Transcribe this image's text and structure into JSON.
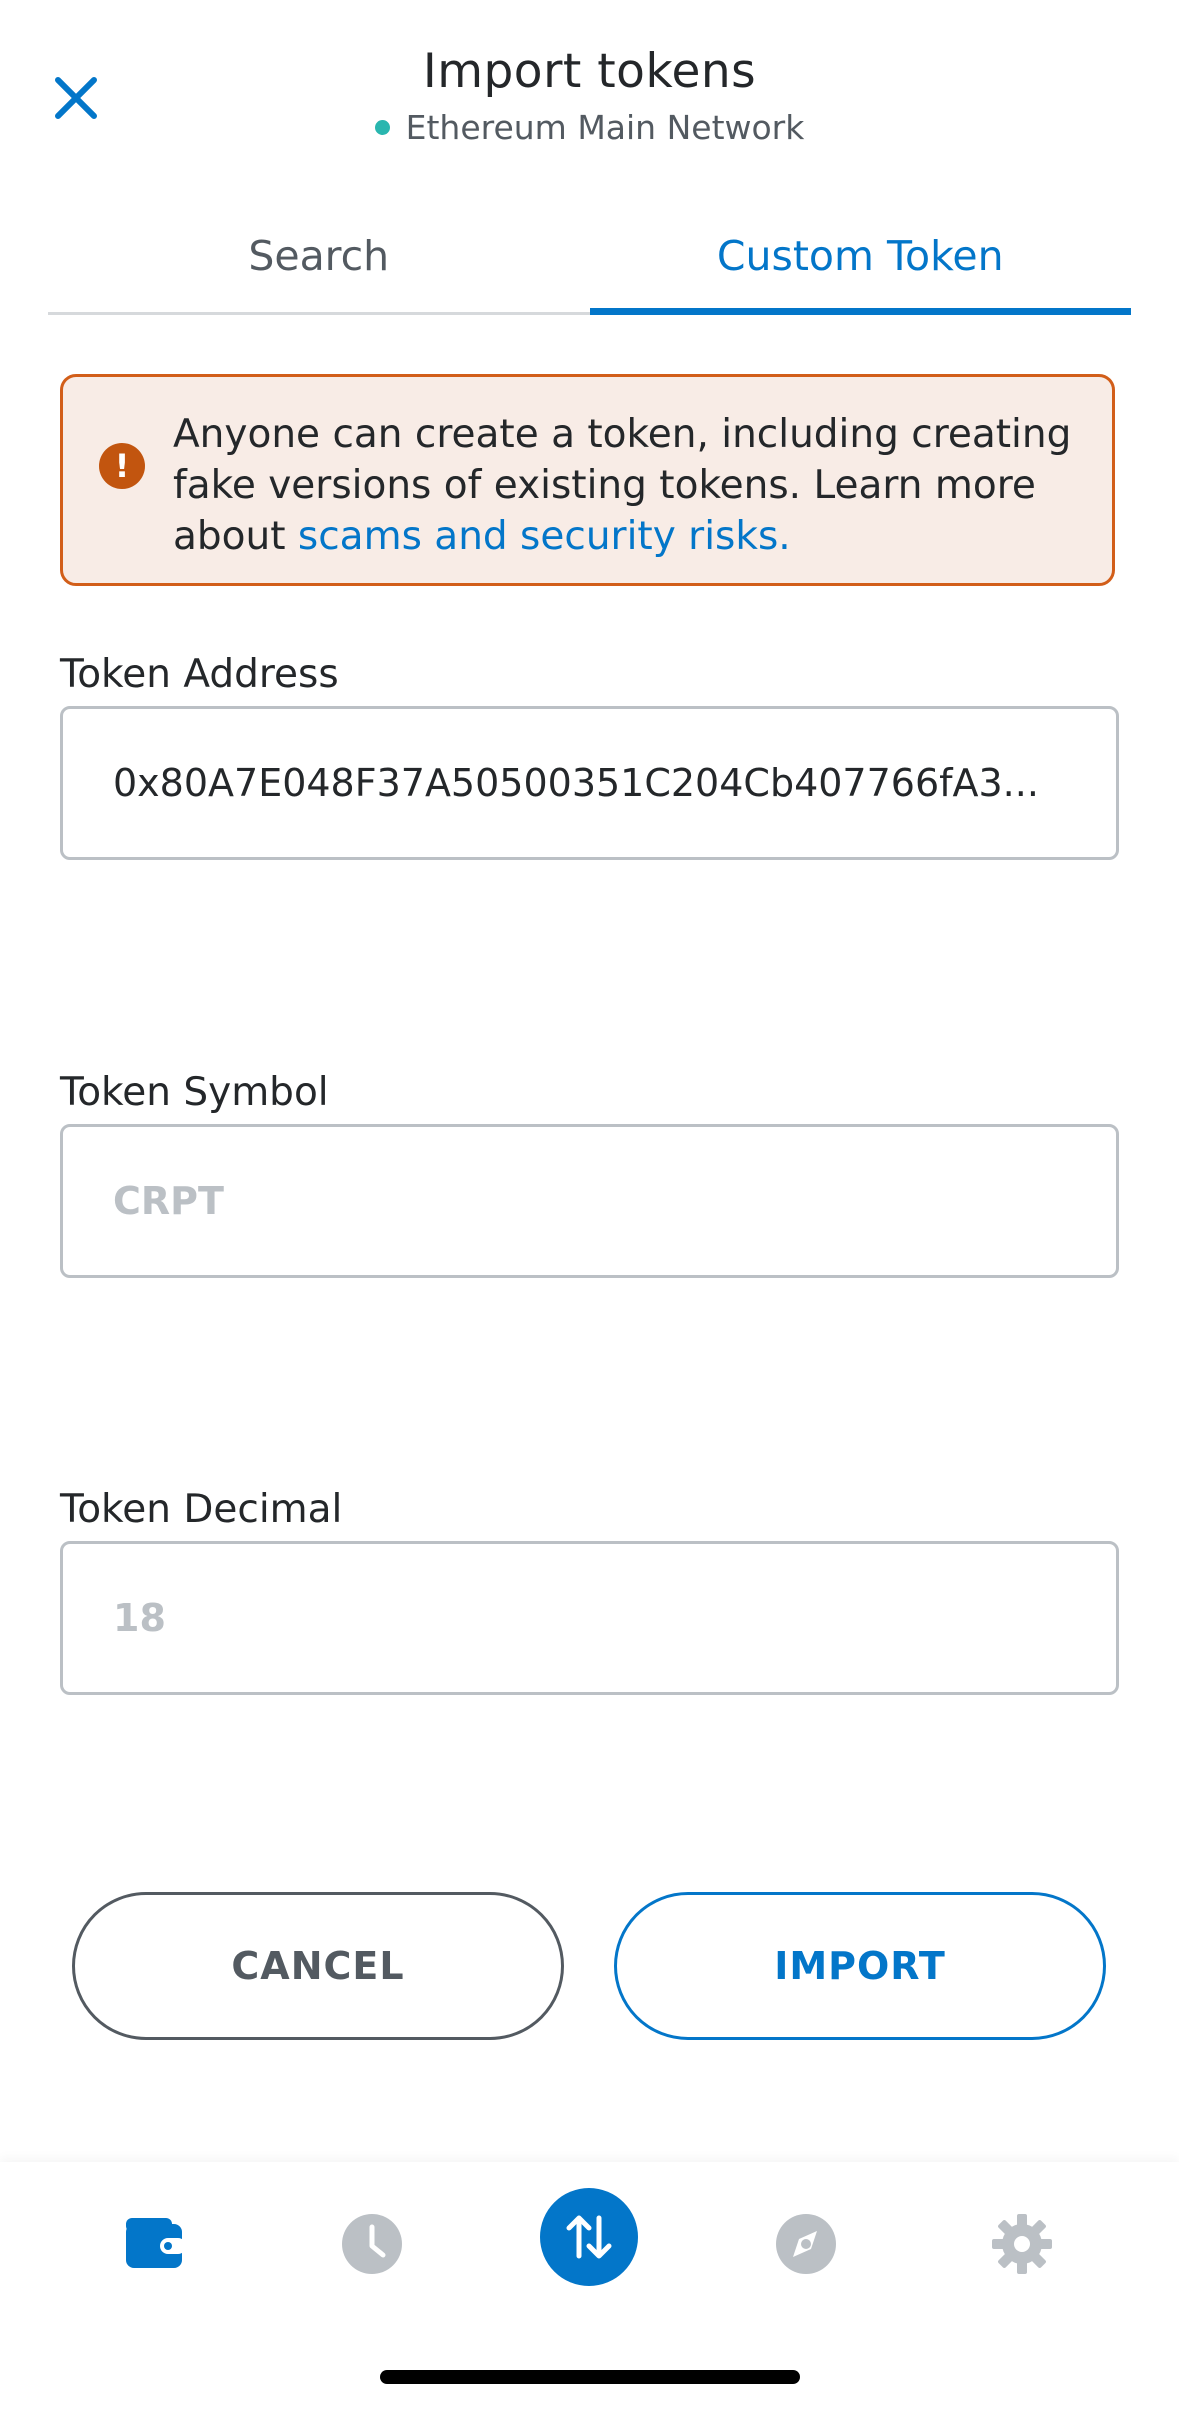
{
  "header": {
    "title": "Import tokens",
    "network": "Ethereum Main Network",
    "network_status_color": "#29b6af"
  },
  "tabs": [
    {
      "label": "Search",
      "active": false
    },
    {
      "label": "Custom Token",
      "active": true
    }
  ],
  "warning": {
    "text_before_link": "Anyone can create a token, including creating fake versions of existing tokens. Learn more about ",
    "link_text": "scams and security risks."
  },
  "fields": {
    "address": {
      "label": "Token Address",
      "value": "0x80A7E048F37A50500351C204Cb407766fA3..."
    },
    "symbol": {
      "label": "Token Symbol",
      "placeholder": "CRPT"
    },
    "decimal": {
      "label": "Token Decimal",
      "placeholder": "18"
    }
  },
  "buttons": {
    "cancel": "CANCEL",
    "import": "IMPORT"
  },
  "bottom_nav": {
    "items": [
      "wallet-icon",
      "activity-clock-icon",
      "swap-icon",
      "browser-compass-icon",
      "settings-gear-icon"
    ],
    "active": "wallet-icon"
  },
  "colors": {
    "accent": "#0376c9",
    "warning_border": "#d25e19",
    "warning_background": "#f8ece6"
  }
}
